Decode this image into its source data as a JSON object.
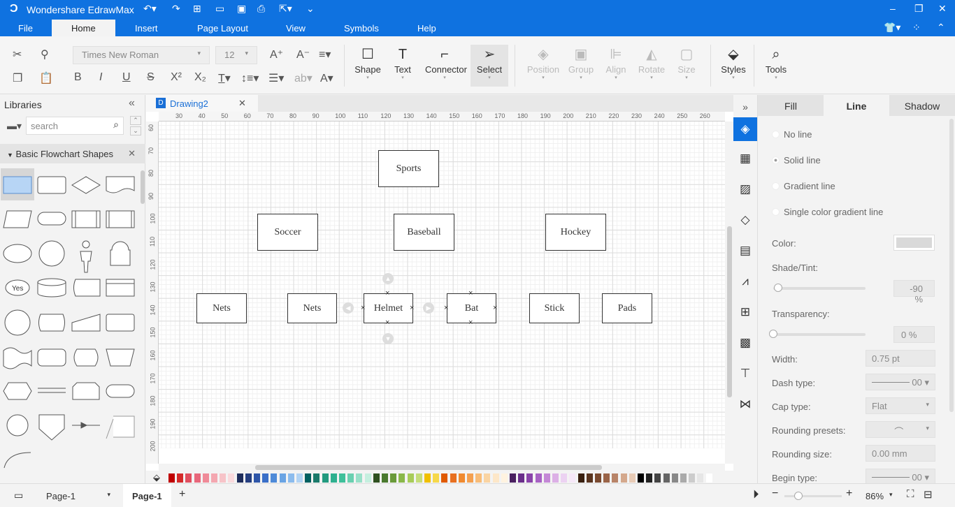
{
  "app": {
    "title": "Wondershare EdrawMax"
  },
  "menu": [
    "File",
    "Home",
    "Insert",
    "Page Layout",
    "View",
    "Symbols",
    "Help"
  ],
  "ribbon": {
    "font": "Times New Roman",
    "size": "12",
    "big": [
      {
        "label": "Shape",
        "icon": "square-icon"
      },
      {
        "label": "Text",
        "icon": "text-icon"
      },
      {
        "label": "Connector",
        "icon": "connector-icon"
      },
      {
        "label": "Select",
        "icon": "pointer-icon"
      },
      {
        "label": "Position",
        "icon": "layers-icon"
      },
      {
        "label": "Group",
        "icon": "group-icon"
      },
      {
        "label": "Align",
        "icon": "align-icon"
      },
      {
        "label": "Rotate",
        "icon": "rotate-icon"
      },
      {
        "label": "Size",
        "icon": "size-icon"
      },
      {
        "label": "Styles",
        "icon": "paint-bucket-icon"
      },
      {
        "label": "Tools",
        "icon": "tools-icon"
      }
    ]
  },
  "library": {
    "title": "Libraries",
    "search_placeholder": "search",
    "category": "Basic Flowchart Shapes",
    "yes_label": "Yes"
  },
  "document": {
    "tab": "Drawing2"
  },
  "ruler": {
    "h": [
      "30",
      "40",
      "50",
      "60",
      "70",
      "80",
      "90",
      "100",
      "110",
      "120",
      "130",
      "140",
      "150",
      "160",
      "170",
      "180",
      "190",
      "200",
      "210",
      "220",
      "230",
      "240",
      "250",
      "260"
    ],
    "v": [
      "60",
      "70",
      "80",
      "90",
      "100",
      "110",
      "120",
      "130",
      "140",
      "150",
      "160",
      "170",
      "180",
      "190",
      "200"
    ]
  },
  "shapes": {
    "sports": "Sports",
    "soccer": "Soccer",
    "baseball": "Baseball",
    "hockey": "Hockey",
    "nets1": "Nets",
    "nets2": "Nets",
    "helmet": "Helmet",
    "bat": "Bat",
    "stick": "Stick",
    "pads": "Pads"
  },
  "palette": [
    "#c00000",
    "#d42a2a",
    "#e04f5f",
    "#e8677b",
    "#ef8a98",
    "#f4a7b0",
    "#f7c3c8",
    "#fadadd",
    "#1f2d5c",
    "#263f80",
    "#2f56a8",
    "#3a6fc8",
    "#4e8ad8",
    "#6aa4e4",
    "#8cbced",
    "#b2d4f4",
    "#006060",
    "#1b7a6b",
    "#229a7f",
    "#2eb08f",
    "#3fc09a",
    "#6ad0b0",
    "#98e0c8",
    "#c5efdf",
    "#2f5020",
    "#4a7a2f",
    "#6a9a3a",
    "#8ab84a",
    "#a8cc5a",
    "#c5dd7a",
    "#f0c000",
    "#f6d84a",
    "#e05a00",
    "#e87020",
    "#f08a30",
    "#f4a050",
    "#f8bc78",
    "#fad4a2",
    "#fde7c8",
    "#fff3e0",
    "#4a2060",
    "#6a2e8a",
    "#8a44aa",
    "#a862c4",
    "#c488d6",
    "#dcb0e6",
    "#ecd2f2",
    "#f6e8f8",
    "#3a2010",
    "#5a3520",
    "#7a4a30",
    "#9a6448",
    "#b88468",
    "#d4a88c",
    "#e8cbb6",
    "#000000",
    "#222222",
    "#444444",
    "#666666",
    "#888888",
    "#aaaaaa",
    "#cccccc",
    "#e6e6e6",
    "#ffffff"
  ],
  "props": {
    "tabs": [
      "Fill",
      "Line",
      "Shadow"
    ],
    "active_tab": "Line",
    "radios": [
      "No line",
      "Solid line",
      "Gradient line",
      "Single color gradient line"
    ],
    "selected_radio": "Solid line",
    "color_label": "Color:",
    "line_color": "#d9d9d9",
    "shade_label": "Shade/Tint:",
    "shade_value": "-90 %",
    "shade_level": -90,
    "transparency_label": "Transparency:",
    "transparency_value": "0 %",
    "transparency_level": 0,
    "width_label": "Width:",
    "width_value": "0.75 pt",
    "dash_label": "Dash type:",
    "dash_value": "00",
    "cap_label": "Cap type:",
    "cap_value": "Flat",
    "rounding_presets_label": "Rounding presets:",
    "rounding_size_label": "Rounding size:",
    "rounding_size_value": "0.00 mm",
    "begin_label": "Begin type:",
    "begin_value": "00"
  },
  "status": {
    "page_select": "Page-1",
    "page_tab": "Page-1",
    "zoom": "86%",
    "zoom_level": 86
  },
  "colors": {
    "accent": "#0f72e0"
  }
}
